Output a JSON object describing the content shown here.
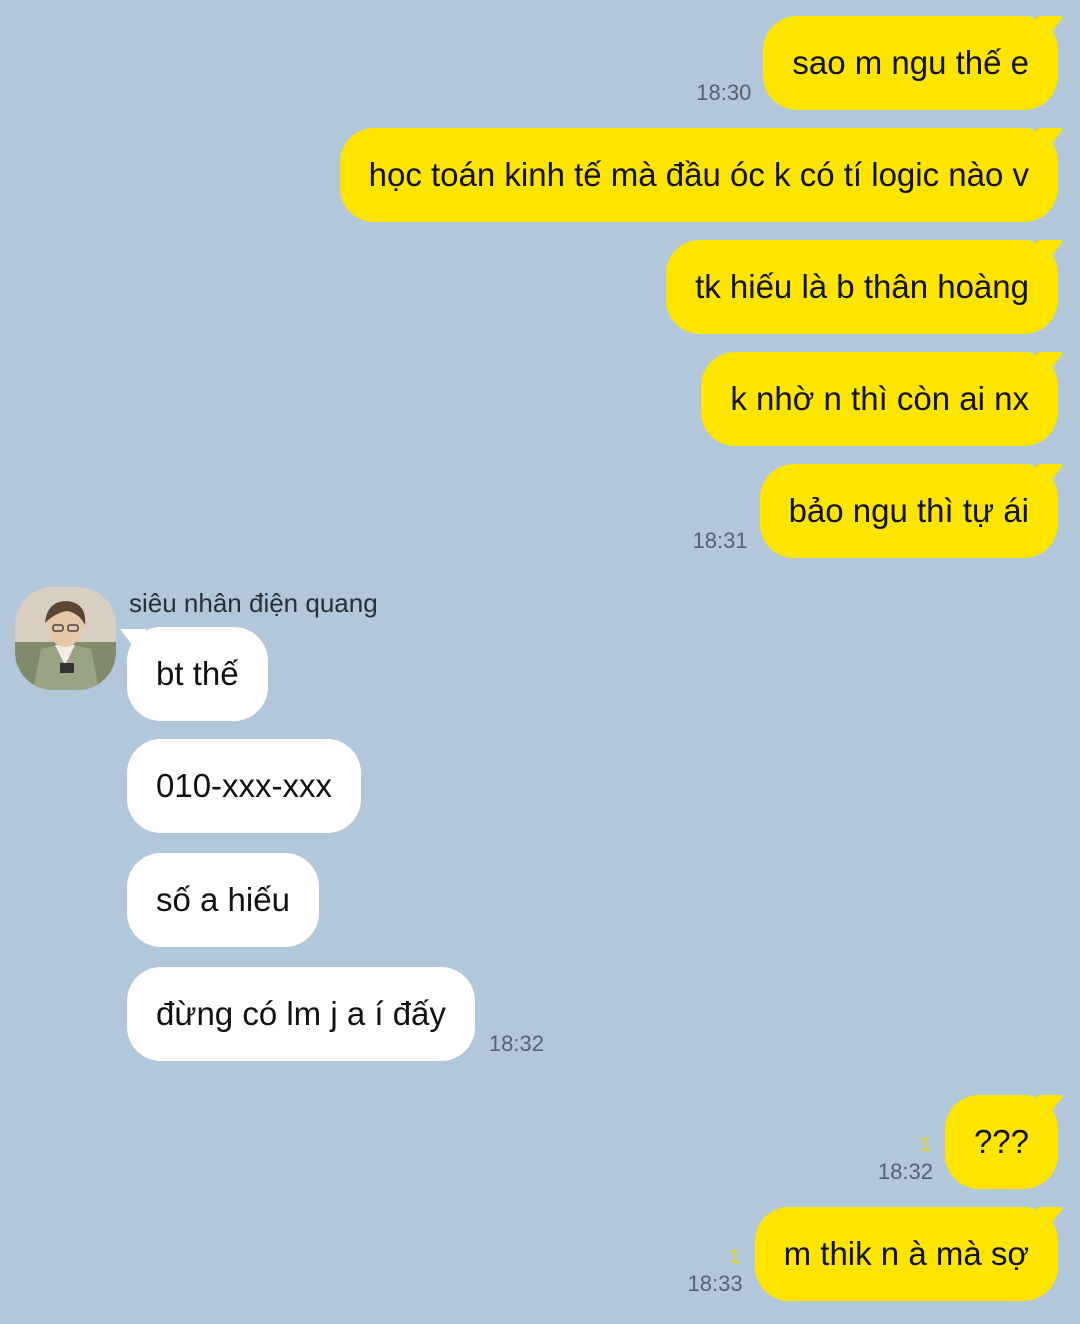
{
  "contact": {
    "name": "siêu nhân điện quang"
  },
  "messages": [
    {
      "dir": "out",
      "text": "sao m ngu thế e",
      "time": "18:30"
    },
    {
      "dir": "out",
      "text": "học toán kinh tế mà đầu óc k có tí logic nào v"
    },
    {
      "dir": "out",
      "text": "tk hiếu là b thân hoàng"
    },
    {
      "dir": "out",
      "text": "k nhờ n thì còn ai nx"
    },
    {
      "dir": "out",
      "text": "bảo ngu thì tự ái",
      "time": "18:31"
    },
    {
      "dir": "in",
      "text": "bt thế"
    },
    {
      "dir": "in",
      "text": "010-xxx-xxx"
    },
    {
      "dir": "in",
      "text": "số a hiếu"
    },
    {
      "dir": "in",
      "text": "đừng có lm j a í đấy",
      "time": "18:32"
    },
    {
      "dir": "out",
      "text": "???",
      "time": "18:32",
      "unread": "1"
    },
    {
      "dir": "out",
      "text": "m thik n à mà sợ",
      "time": "18:33",
      "unread": "1"
    }
  ],
  "colors": {
    "background": "#b2c7da",
    "outgoing_bubble": "#fee500",
    "incoming_bubble": "#ffffff",
    "unread_counter": "#e8d100"
  }
}
